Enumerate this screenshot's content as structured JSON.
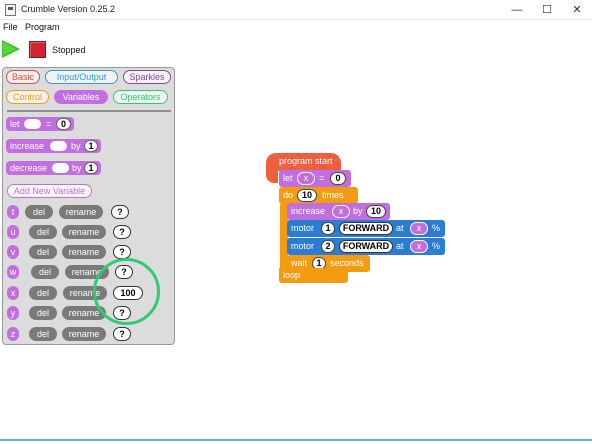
{
  "window": {
    "title": "Crumble Version 0.25.2",
    "minimize": "—",
    "maximize": "☐",
    "close": "✕"
  },
  "menu": {
    "file": "File",
    "program": "Program"
  },
  "toolbar": {
    "status": "Stopped"
  },
  "palette": {
    "categories": [
      {
        "label": "Basic",
        "color": "#e74c3c"
      },
      {
        "label": "Input/Output",
        "color": "#3498db"
      },
      {
        "label": "Sparkles",
        "color": "#8e44ad"
      },
      {
        "label": "Control",
        "color": "#f39c12"
      },
      {
        "label": "Variables",
        "color": "#c16fe0"
      },
      {
        "label": "Operators",
        "color": "#2ecc71"
      }
    ],
    "let_block": {
      "label": "let",
      "eq": "=",
      "value": "0"
    },
    "increase_block": {
      "label": "increase",
      "by": "by",
      "value": "1"
    },
    "decrease_block": {
      "label": "decrease",
      "by": "by",
      "value": "1"
    },
    "add_variable": "Add New Variable",
    "variables": [
      {
        "name": "t",
        "del": "del",
        "rename": "rename",
        "value": "?"
      },
      {
        "name": "u",
        "del": "del",
        "rename": "rename",
        "value": "?"
      },
      {
        "name": "v",
        "del": "del",
        "rename": "rename",
        "value": "?"
      },
      {
        "name": "w",
        "del": "del",
        "rename": "rename",
        "value": "?"
      },
      {
        "name": "x",
        "del": "del",
        "rename": "rename",
        "value": "100"
      },
      {
        "name": "y",
        "del": "del",
        "rename": "rename",
        "value": "?"
      },
      {
        "name": "z",
        "del": "del",
        "rename": "rename",
        "value": "?"
      }
    ]
  },
  "program": {
    "start": "program start",
    "let": {
      "label": "let",
      "var": "x",
      "eq": "=",
      "value": "0"
    },
    "do": {
      "label": "do",
      "count": "10",
      "suffix": "times"
    },
    "increase": {
      "label": "increase",
      "var": "x",
      "by": "by",
      "value": "10"
    },
    "motor1": {
      "label": "motor",
      "num": "1",
      "dir": "FORWARD",
      "at": "at",
      "var": "x",
      "pct": "%"
    },
    "motor2": {
      "label": "motor",
      "num": "2",
      "dir": "FORWARD",
      "at": "at",
      "var": "x",
      "pct": "%"
    },
    "wait": {
      "label": "wait",
      "value": "1",
      "suffix": "seconds"
    },
    "loop": "loop"
  },
  "colors": {
    "variables": "#c16fe0",
    "control": "#f39c12",
    "motor": "#2b7cd3",
    "start": "#ee5f3d",
    "highlight": "#2ecc71"
  }
}
